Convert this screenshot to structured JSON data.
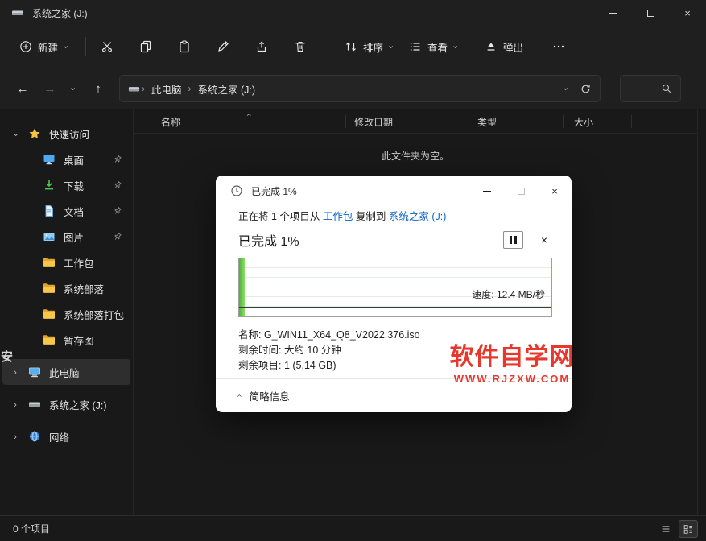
{
  "window": {
    "title": "系统之家 (J:)"
  },
  "icons": {
    "back": "←",
    "forward": "→",
    "up": "↑",
    "chevron": "›",
    "close": "×"
  },
  "toolbar": {
    "new": "新建",
    "sort": "排序",
    "view": "查看",
    "eject": "弹出"
  },
  "navbar": {
    "breadcrumb": [
      "此电脑",
      "系统之家 (J:)"
    ]
  },
  "sidebar": {
    "items": [
      {
        "label": "快速访问",
        "expanded": true
      },
      {
        "label": "桌面",
        "pinned": true
      },
      {
        "label": "下载",
        "pinned": true
      },
      {
        "label": "文档",
        "pinned": true
      },
      {
        "label": "图片",
        "pinned": true
      },
      {
        "label": "工作包"
      },
      {
        "label": "系统部落"
      },
      {
        "label": "系统部落打包"
      },
      {
        "label": "暂存图"
      },
      {
        "label": "此电脑",
        "selected": true
      },
      {
        "label": "系统之家 (J:)"
      },
      {
        "label": "网络"
      }
    ]
  },
  "main": {
    "columns": [
      "名称",
      "修改日期",
      "类型",
      "大小"
    ],
    "empty_text": "此文件夹为空。"
  },
  "dialog": {
    "title": "已完成 1%",
    "copy_prefix": "正在将 1 个项目从 ",
    "copy_from": "工作包",
    "copy_mid": " 复制到 ",
    "copy_to": "系统之家 (J:)",
    "progress_label": "已完成 1%",
    "progress_percent": 1,
    "speed_label": "速度: 12.4 MB/秒",
    "name_line": "名称: G_WIN11_X64_Q8_V2022.376.iso",
    "time_line": "剩余时间: 大约 10 分钟",
    "items_line": "剩余项目: 1 (5.14 GB)",
    "details_label": "简略信息"
  },
  "watermark": {
    "line1": "软件自学网",
    "line2": "WWW.RJZXW.COM",
    "edge_fragment": "安",
    "color": "#e8372c"
  },
  "statusbar": {
    "count_label": "0 个项目"
  },
  "colors": {
    "link": "#0a63c9",
    "accent_green": "#6fd14f",
    "chrome_bg": "#1f1f1f",
    "body_bg": "#191919",
    "dialog_bg": "#ffffff"
  }
}
